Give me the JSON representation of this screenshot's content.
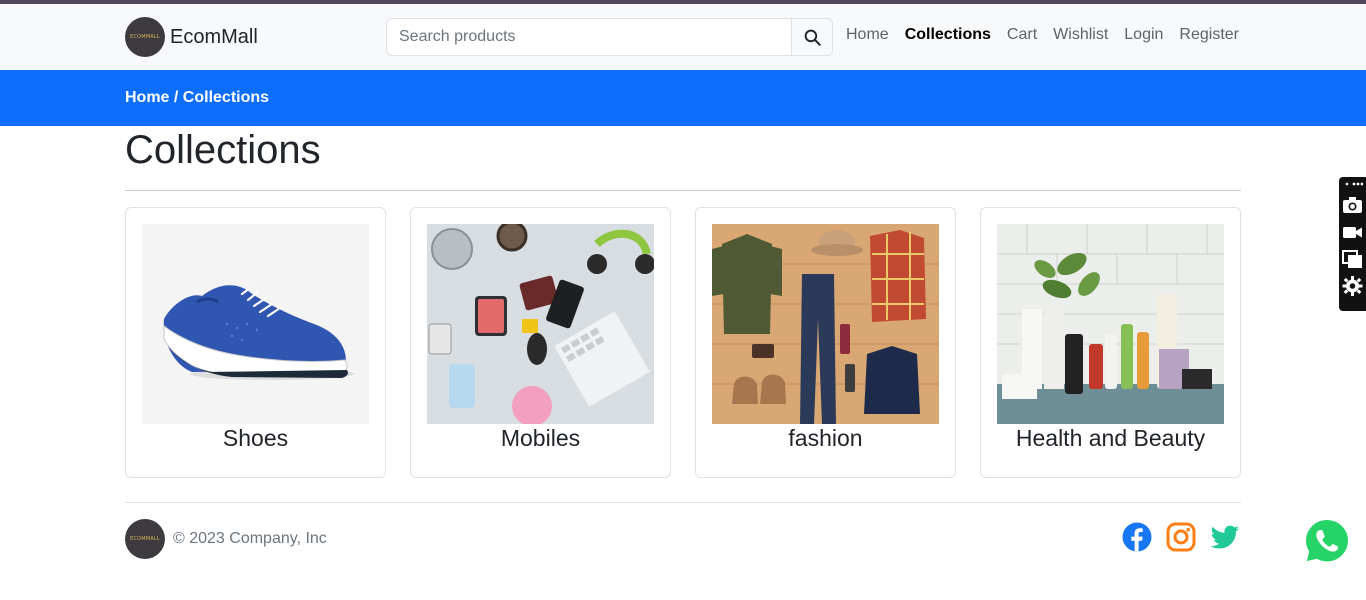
{
  "header": {
    "brand_name": "EcomMall",
    "logo_text": "ECOMMALL",
    "search": {
      "placeholder": "Search products",
      "value": ""
    },
    "nav": [
      {
        "label": "Home",
        "active": false
      },
      {
        "label": "Collections",
        "active": true
      },
      {
        "label": "Cart",
        "active": false
      },
      {
        "label": "Wishlist",
        "active": false
      },
      {
        "label": "Login",
        "active": false
      },
      {
        "label": "Register",
        "active": false
      }
    ]
  },
  "breadcrumb": {
    "home": "Home",
    "separator": " / ",
    "current": "Collections"
  },
  "page_title": "Collections",
  "collections": [
    {
      "title": "Shoes",
      "image": "blue-sneaker-photo"
    },
    {
      "title": "Mobiles",
      "image": "electronics-flatlay-photo"
    },
    {
      "title": "fashion",
      "image": "clothing-flatlay-photo"
    },
    {
      "title": "Health and Beauty",
      "image": "beauty-products-photo"
    }
  ],
  "footer": {
    "copyright": "© 2023 Company, Inc",
    "socials": [
      {
        "name": "facebook-icon",
        "color": "#1877f2"
      },
      {
        "name": "instagram-icon",
        "color": "#fd7e14"
      },
      {
        "name": "twitter-icon",
        "color": "#20c997"
      }
    ]
  },
  "colors": {
    "accent": "#0d6efd",
    "navbar_bg": "#f8f9fa",
    "whatsapp": "#25d366"
  },
  "screen_tools": [
    "camera-icon",
    "video-icon",
    "window-icon",
    "gear-icon"
  ]
}
